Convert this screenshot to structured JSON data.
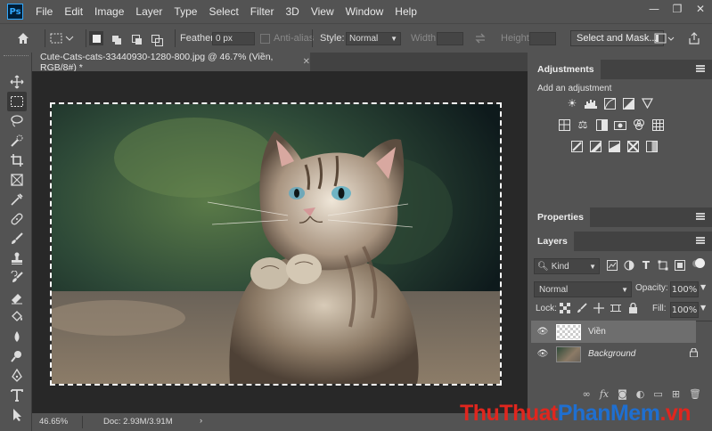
{
  "app": {
    "logo": "Ps"
  },
  "menu": [
    "File",
    "Edit",
    "Image",
    "Layer",
    "Type",
    "Select",
    "Filter",
    "3D",
    "View",
    "Window",
    "Help"
  ],
  "options_bar": {
    "feather_label": "Feather:",
    "feather_value": "0 px",
    "antialias_label": "Anti-alias",
    "style_label": "Style:",
    "style_value": "Normal",
    "width_label": "Width:",
    "height_label": "Height:",
    "select_mask_label": "Select and Mask..."
  },
  "document": {
    "tab_title": "Cute-Cats-cats-33440930-1280-800.jpg @ 46.7% (Viền, RGB/8#) *",
    "zoom": "46.65%",
    "doc_size": "Doc: 2.93M/3.91M"
  },
  "panels": {
    "adjustments": {
      "title": "Adjustments",
      "subtitle": "Add an adjustment"
    },
    "properties": {
      "title": "Properties"
    },
    "layers": {
      "title": "Layers",
      "filter_kind": "Kind",
      "blend_mode": "Normal",
      "opacity_label": "Opacity:",
      "opacity_value": "100%",
      "lock_label": "Lock:",
      "fill_label": "Fill:",
      "fill_value": "100%",
      "items": [
        {
          "name": "Viền",
          "selected": true
        },
        {
          "name": "Background",
          "locked": true
        }
      ]
    }
  },
  "watermark": {
    "part1": "ThuThuat",
    "part2": "PhanMem",
    "part3": ".vn"
  },
  "colors": {
    "ui_bg": "#535353",
    "canvas_bg": "#282828",
    "panel_header": "#424242",
    "selection_row": "#6e6e6e"
  }
}
